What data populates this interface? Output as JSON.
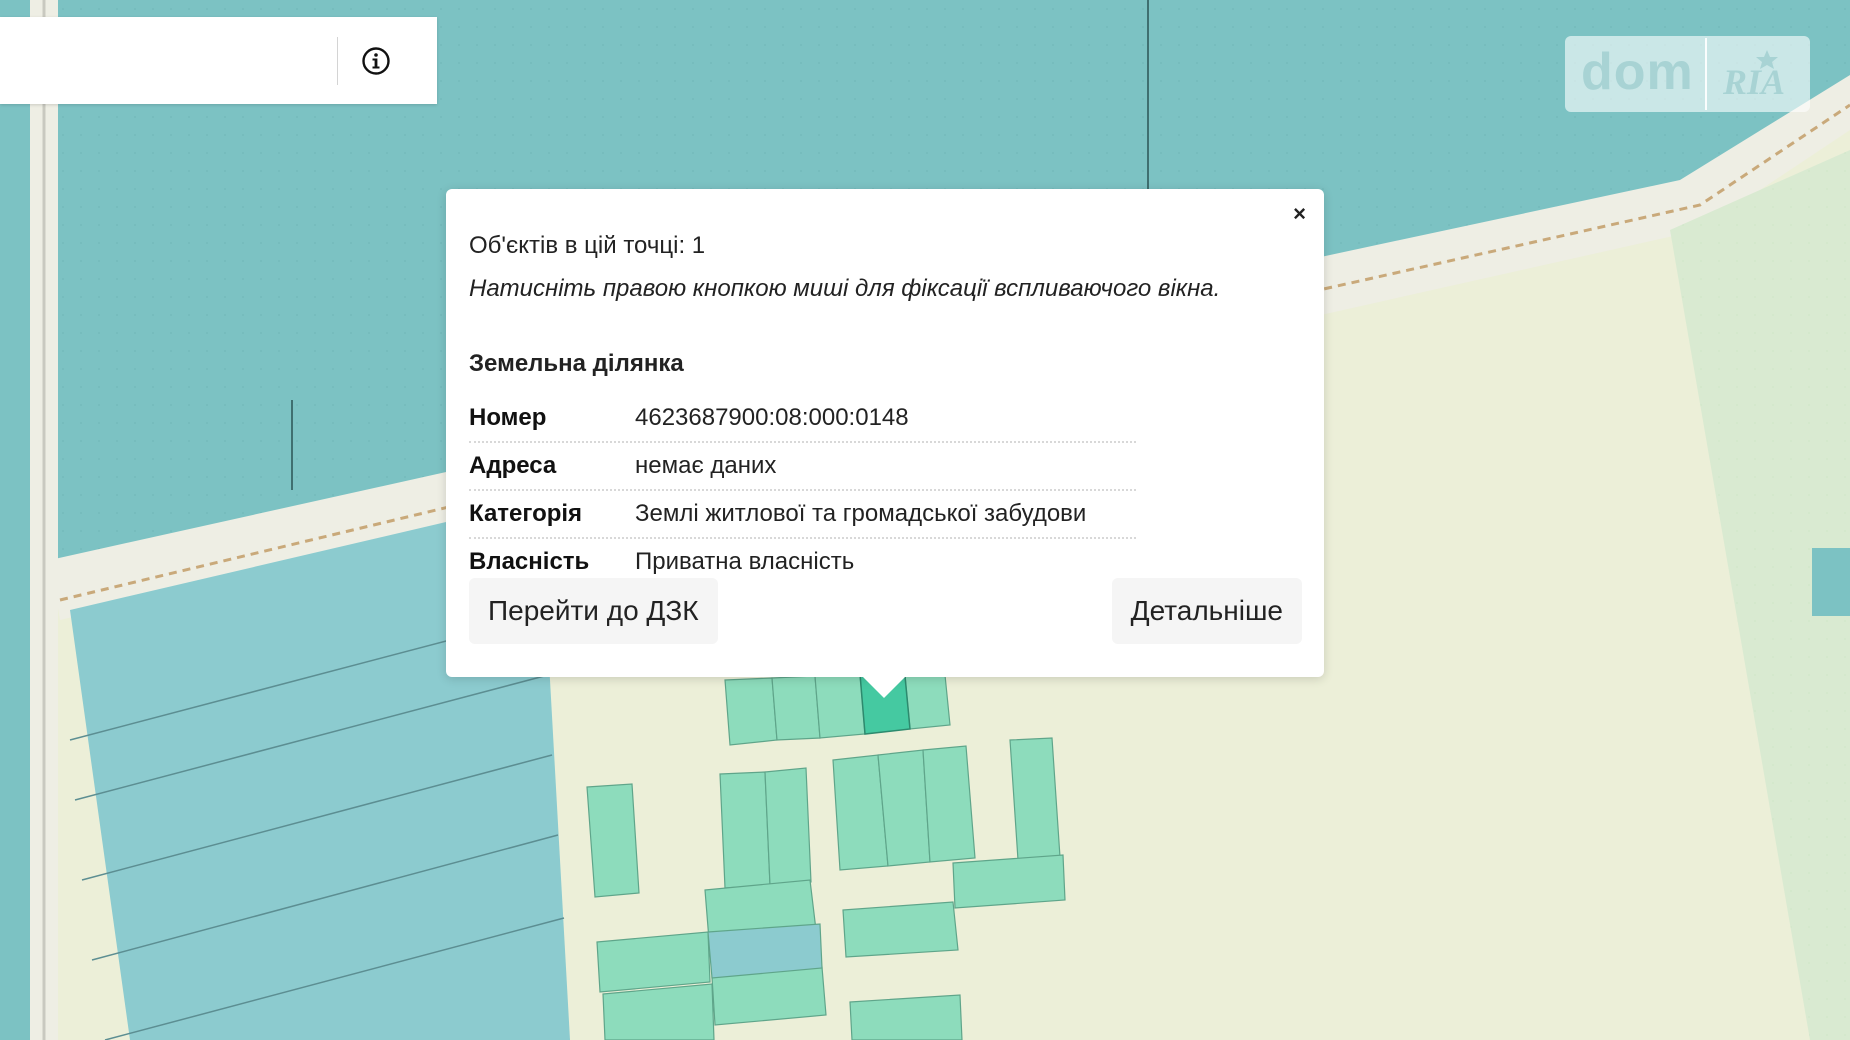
{
  "search": {
    "value": "",
    "placeholder": ""
  },
  "info_icon": "info-circle-icon",
  "logo": {
    "dom_text": "dom",
    "ria_text": "RIA"
  },
  "popup": {
    "close_label": "×",
    "objects_count": "Об'єктів в цій точці: 1",
    "hint": "Натисніть правою кнопкою миші для фіксації вспливаючого вікна.",
    "section_title": "Земельна ділянка",
    "properties": [
      {
        "key": "Номер",
        "value": "4623687900:08:000:0148"
      },
      {
        "key": "Адреса",
        "value": "немає даних"
      },
      {
        "key": "Категорія",
        "value": "Землі житлової та громадської забудови"
      },
      {
        "key": "Власність",
        "value": "Приватна власність"
      }
    ],
    "button_dzk": "Перейти до ДЗК",
    "button_details": "Детальніше"
  },
  "colors": {
    "teal_zone": "#7cc2c3",
    "blue_parcel": "#8ccbcf",
    "green_parcel": "#8ddcbc",
    "selected_parcel": "#45c9a1",
    "residential_bg": "#ecefd8",
    "road": "#eeeee4"
  }
}
